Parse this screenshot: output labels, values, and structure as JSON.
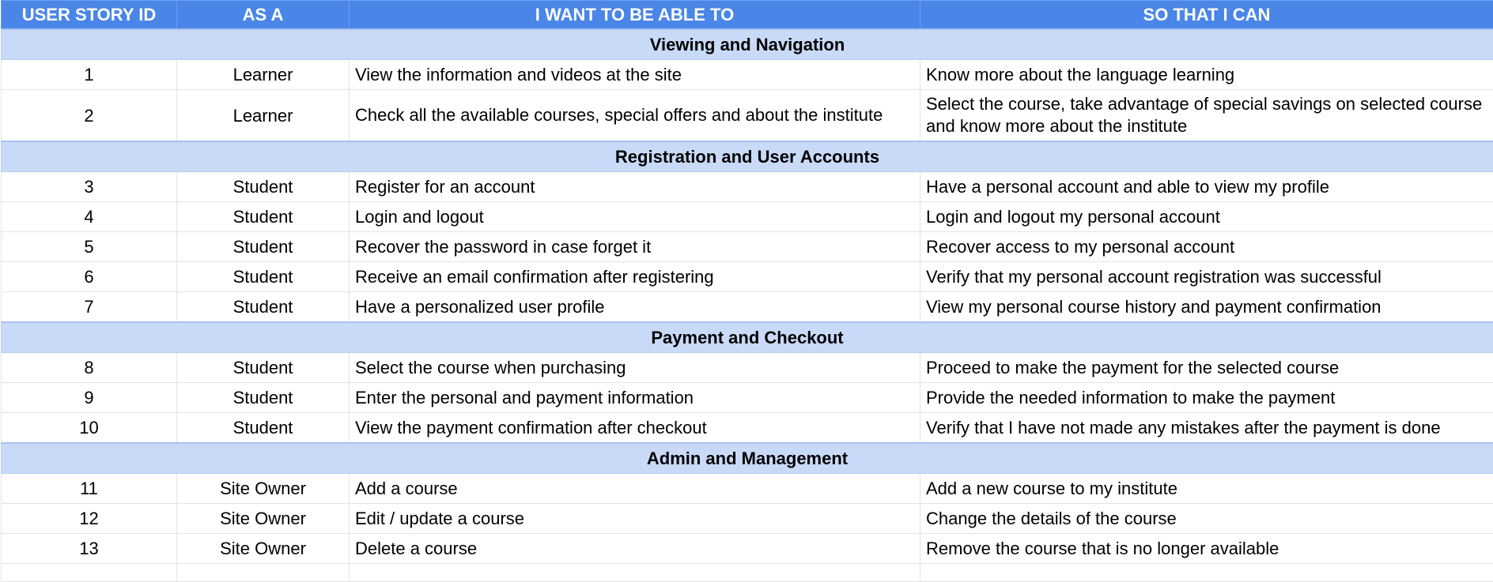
{
  "table": {
    "headers": [
      "USER STORY ID",
      "AS A",
      "I WANT TO BE ABLE TO",
      "SO THAT I CAN"
    ],
    "sections": [
      {
        "title": "Viewing and Navigation",
        "rows": [
          {
            "id": "1",
            "role": "Learner",
            "want": "View the information and videos at the site",
            "so_that": "Know more about the language learning"
          },
          {
            "id": "2",
            "role": "Learner",
            "want": "Check all the available courses, special offers and about the institute",
            "so_that": "Select the course, take advantage of special savings on selected course and know more about the institute"
          }
        ]
      },
      {
        "title": "Registration and User Accounts",
        "rows": [
          {
            "id": "3",
            "role": "Student",
            "want": "Register for an account",
            "so_that": "Have a personal account and able to view my profile"
          },
          {
            "id": "4",
            "role": "Student",
            "want": "Login and logout",
            "so_that": "Login and logout my personal account"
          },
          {
            "id": "5",
            "role": "Student",
            "want": "Recover the password in case forget it",
            "so_that": "Recover access to my personal account"
          },
          {
            "id": "6",
            "role": "Student",
            "want": "Receive an email confirmation after registering",
            "so_that": "Verify that my personal account registration was successful"
          },
          {
            "id": "7",
            "role": "Student",
            "want": "Have a personalized user profile",
            "so_that": "View my personal course history and payment confirmation"
          }
        ]
      },
      {
        "title": "Payment and Checkout",
        "rows": [
          {
            "id": "8",
            "role": "Student",
            "want": "Select the course when purchasing",
            "so_that": "Proceed to make the payment for the selected course"
          },
          {
            "id": "9",
            "role": "Student",
            "want": "Enter the personal and payment information",
            "so_that": "Provide the needed information to make the payment"
          },
          {
            "id": "10",
            "role": "Student",
            "want": "View the payment confirmation after checkout",
            "so_that": "Verify that I have not made any mistakes after the payment is done"
          }
        ]
      },
      {
        "title": "Admin and Management",
        "rows": [
          {
            "id": "11",
            "role": "Site Owner",
            "want": "Add a course",
            "so_that": "Add a new course to my institute"
          },
          {
            "id": "12",
            "role": "Site Owner",
            "want": "Edit / update a course",
            "so_that": "Change the details of the course"
          },
          {
            "id": "13",
            "role": "Site Owner",
            "want": "Delete a course",
            "so_that": "Remove the course that is no longer available"
          }
        ]
      }
    ]
  },
  "colors": {
    "header_bg": "#4a86e8",
    "section_bg": "#c9daf8",
    "grid": "#e3e3e3"
  }
}
